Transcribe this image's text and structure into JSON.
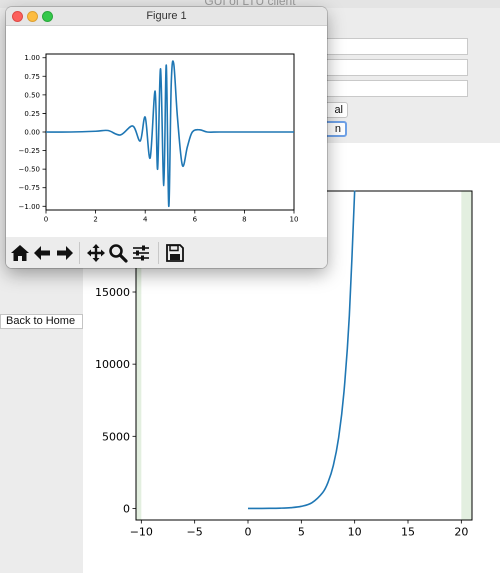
{
  "app": {
    "title": "GUI of LTU client",
    "fields": [
      "",
      "",
      ""
    ],
    "buttons": [
      "al",
      "n"
    ],
    "back_button": "Back to Home"
  },
  "figure": {
    "window_title": "Figure 1",
    "toolbar": [
      "home-icon",
      "back-arrow-icon",
      "forward-arrow-icon",
      "pan-icon",
      "zoom-icon",
      "configure-subplots-icon",
      "save-icon"
    ]
  },
  "colors": {
    "line": "#1f77b4",
    "span": "#e3efe0",
    "axes": "#000000"
  },
  "chart_data": [
    {
      "type": "line",
      "name": "figure1_wavelet",
      "title": "",
      "xlabel": "",
      "ylabel": "",
      "xlim": [
        0,
        10
      ],
      "ylim": [
        -1.05,
        1.05
      ],
      "xticks": [
        0,
        2,
        4,
        6,
        8,
        10
      ],
      "yticks": [
        -1.0,
        -0.75,
        -0.5,
        -0.25,
        0.0,
        0.25,
        0.5,
        0.75,
        1.0
      ],
      "ytick_labels": [
        "−1.00",
        "−0.75",
        "−0.50",
        "−0.25",
        "0.00",
        "0.25",
        "0.50",
        "0.75",
        "1.00"
      ],
      "x": [
        0,
        1,
        2,
        2.5,
        3,
        3.5,
        3.8,
        4,
        4.2,
        4.4,
        4.5,
        4.62,
        4.75,
        4.85,
        4.95,
        5.05,
        5.15,
        5.3,
        5.5,
        5.7,
        5.9,
        6.2,
        6.5,
        7,
        8,
        9,
        10
      ],
      "y": [
        0,
        0,
        0.01,
        0.02,
        -0.04,
        0.08,
        -0.12,
        0.2,
        -0.35,
        0.55,
        -0.5,
        0.85,
        -0.72,
        0.9,
        -1.0,
        0.65,
        0.92,
        0.2,
        -0.45,
        -0.2,
        0.0,
        0.03,
        0.0,
        0.0,
        0.0,
        0.0,
        0.0
      ],
      "grid": false
    },
    {
      "type": "line",
      "name": "main_exponential",
      "title": "",
      "xlabel": "",
      "ylabel": "",
      "xlim": [
        -10.5,
        21
      ],
      "ylim": [
        -800,
        22000
      ],
      "xticks": [
        -10,
        -5,
        0,
        5,
        10,
        15,
        20
      ],
      "xtick_labels": [
        "−10",
        "−5",
        "0",
        "5",
        "10",
        "15",
        "20"
      ],
      "yticks": [
        0,
        5000,
        10000,
        15000
      ],
      "x": [
        0,
        1,
        2,
        3,
        4,
        5,
        6,
        7,
        7.5,
        8,
        8.5,
        9,
        9.5,
        10
      ],
      "y": [
        0,
        3,
        7,
        20,
        55,
        148,
        403,
        1097,
        1808,
        2981,
        4915,
        8103,
        13360,
        22026
      ],
      "shaded_spans": [
        [
          -10.5,
          -10
        ],
        [
          20,
          21
        ]
      ],
      "grid": false
    }
  ]
}
